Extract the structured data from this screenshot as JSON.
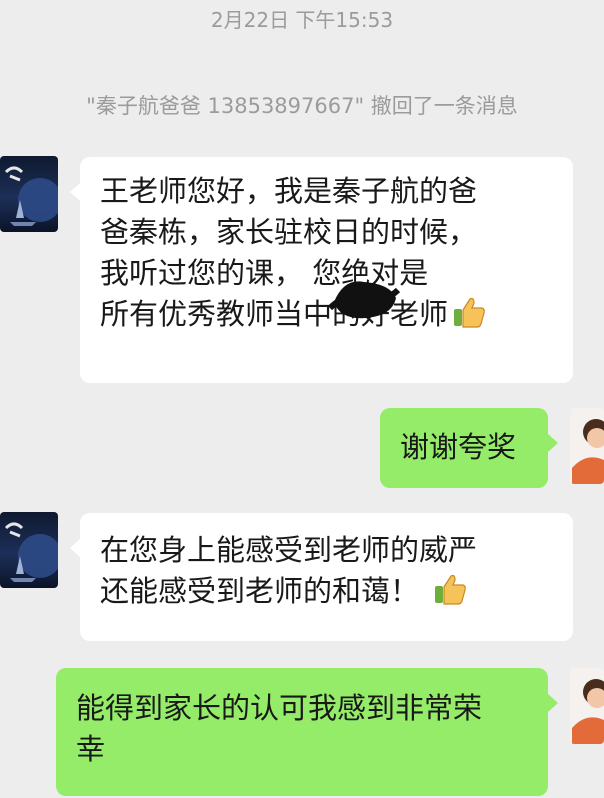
{
  "chat": {
    "timestamp": "2月22日 下午15:53",
    "recall_notice": "\"秦子航爸爸 13853897667\" 撤回了一条消息",
    "messages": [
      {
        "sender": "parent",
        "lines": [
          "王老师您好，我是秦子航的爸",
          "爸秦栋，家长驻校日的时候，",
          "我听过您的课，  您绝对是",
          "所有优秀教师当中的好老师"
        ],
        "emoji": "thumbs-up-icon"
      },
      {
        "sender": "self",
        "lines": [
          "谢谢夸奖"
        ]
      },
      {
        "sender": "parent",
        "lines": [
          "在您身上能感受到老师的威严",
          "还能感受到老师的和蔼！"
        ],
        "emoji": "thumbs-up-icon"
      },
      {
        "sender": "self",
        "lines": [
          "能得到家长的认可我感到非常荣",
          "幸"
        ]
      }
    ]
  },
  "colors": {
    "background": "#ededed",
    "incoming_bubble": "#ffffff",
    "outgoing_bubble": "#95ec69",
    "system_text": "#9b9b9b"
  }
}
